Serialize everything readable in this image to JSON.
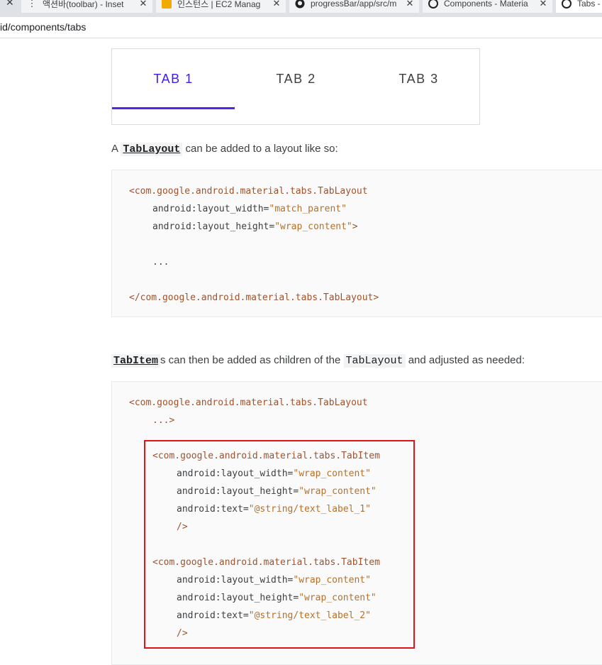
{
  "browser": {
    "tabs": [
      {
        "title": "액션바(toolbar) - Inset"
      },
      {
        "title": "인스턴스 | EC2 Manag"
      },
      {
        "title": "progressBar/app/src/m"
      },
      {
        "title": "Components - Materia"
      },
      {
        "title": "Tabs -"
      }
    ],
    "address": "id/components/tabs"
  },
  "demo": {
    "tabs": [
      "TAB 1",
      "TAB 2",
      "TAB 3"
    ],
    "selected_index": 0,
    "colors": {
      "selected": "#3d1cf0",
      "indicator": "#5a22e8"
    }
  },
  "para1": {
    "prefix": "A ",
    "code": "TabLayout",
    "suffix": " can be added to a layout like so:"
  },
  "code1": {
    "open_tag": "<com.google.android.material.tabs.TabLayout",
    "attr1": "android:layout_width=",
    "val1": "\"match_parent\"",
    "attr2": "android:layout_height=",
    "val2": "\"wrap_content\"",
    "close_bracket": ">",
    "ellipsis": "...",
    "close_tag": "</com.google.android.material.tabs.TabLayout>"
  },
  "para2": {
    "code1": "TabItem",
    "mid": "s can then be added as children of the ",
    "code2": "TabLayout",
    "suffix": " and adjusted as needed:"
  },
  "code2": {
    "open_tag": "<com.google.android.material.tabs.TabLayout",
    "ellipsis": "...>",
    "item_tag": "<com.google.android.material.tabs.TabItem",
    "attr_w": "android:layout_width=",
    "attr_h": "android:layout_height=",
    "val_wrap": "\"wrap_content\"",
    "attr_text": "android:text=",
    "val_text1": "\"@string/text_label_1\"",
    "val_text2": "\"@string/text_label_2\"",
    "self_close": "/>"
  },
  "highlight_color": "#e0141b"
}
